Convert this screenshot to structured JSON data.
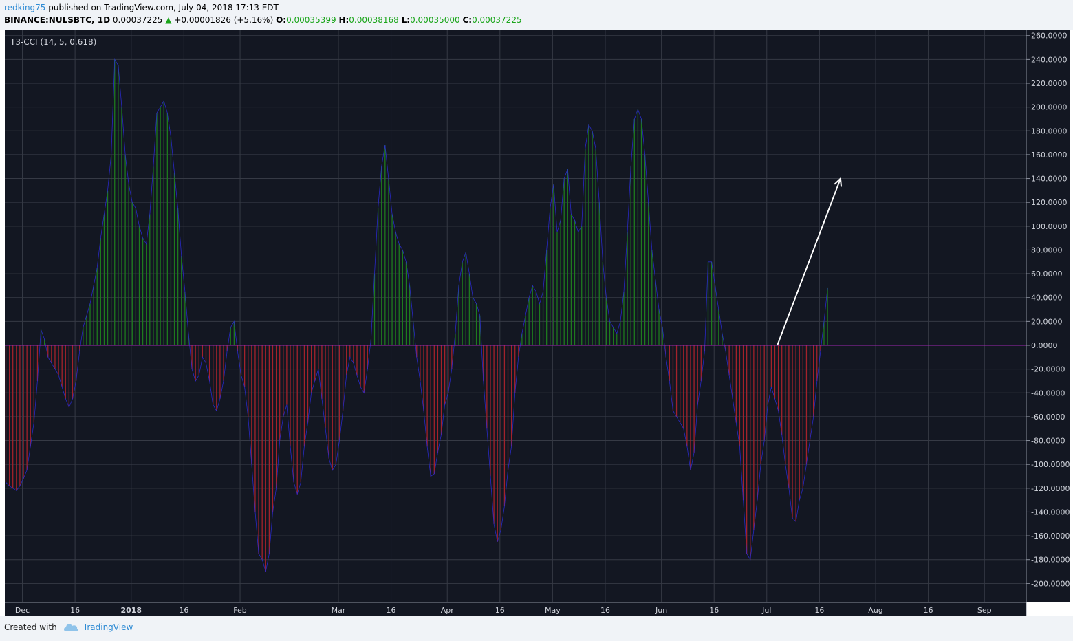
{
  "header": {
    "user": "redking75",
    "published": " published on TradingView.com, July 04, 2018 17:13 EDT",
    "symbol": "BINANCE:NULSBTC, 1D",
    "price": "0.00037225",
    "change": "+0.00001826 (+5.16%)",
    "o_label": "O:",
    "o_val": "0.00035399",
    "h_label": "H:",
    "h_val": "0.00038168",
    "l_label": "L:",
    "l_val": "0.00035000",
    "c_label": "C:",
    "c_val": "0.00037225"
  },
  "footer": {
    "created": "Created with",
    "brand": "TradingView"
  },
  "colors": {
    "background": "#131722",
    "grid": "#363a45",
    "positive": "#1e7a1e",
    "negative": "#a3222b",
    "outline": "#2b2bd6",
    "zero_line": "#9c27b0",
    "annotation": "#ffffff"
  },
  "chart_data": {
    "type": "bar",
    "indicator_label": "T3-CCI (14, 5, 0.618)",
    "ylim": [
      -200,
      260
    ],
    "y_ticks": [
      "260.0000",
      "240.0000",
      "220.0000",
      "200.0000",
      "180.0000",
      "160.0000",
      "140.0000",
      "120.0000",
      "100.0000",
      "80.0000",
      "60.0000",
      "40.0000",
      "20.0000",
      "0.0000",
      "-20.0000",
      "-40.0000",
      "-60.0000",
      "-80.0000",
      "-100.0000",
      "-120.0000",
      "-140.0000",
      "-160.0000",
      "-180.0000",
      "-200.0000"
    ],
    "x_ticks": [
      {
        "label": "Dec",
        "date": "2017-12-01"
      },
      {
        "label": "16",
        "date": "2017-12-16"
      },
      {
        "label": "2018",
        "date": "2018-01-01"
      },
      {
        "label": "16",
        "date": "2018-01-16"
      },
      {
        "label": "Feb",
        "date": "2018-02-01"
      },
      {
        "label": "Mar",
        "date": "2018-03-01"
      },
      {
        "label": "16",
        "date": "2018-03-16"
      },
      {
        "label": "Apr",
        "date": "2018-04-01"
      },
      {
        "label": "16",
        "date": "2018-04-16"
      },
      {
        "label": "May",
        "date": "2018-05-01"
      },
      {
        "label": "16",
        "date": "2018-05-16"
      },
      {
        "label": "Jun",
        "date": "2018-06-01"
      },
      {
        "label": "16",
        "date": "2018-06-16"
      },
      {
        "label": "Jul",
        "date": "2018-07-01"
      },
      {
        "label": "16",
        "date": "2018-07-16"
      },
      {
        "label": "Aug",
        "date": "2018-08-01"
      },
      {
        "label": "16",
        "date": "2018-08-16"
      },
      {
        "label": "Sep",
        "date": "2018-09-01"
      }
    ],
    "date_start": "2017-11-26",
    "date_end": "2018-09-13",
    "values": [
      -115,
      -118,
      -120,
      -122,
      -118,
      -112,
      -105,
      -85,
      -65,
      -30,
      13,
      5,
      -10,
      -15,
      -20,
      -25,
      -35,
      -45,
      -52,
      -45,
      -30,
      -5,
      15,
      25,
      35,
      50,
      65,
      90,
      110,
      130,
      160,
      240,
      235,
      200,
      160,
      135,
      120,
      115,
      100,
      90,
      85,
      110,
      150,
      195,
      200,
      205,
      195,
      175,
      145,
      115,
      75,
      45,
      10,
      -20,
      -30,
      -25,
      -10,
      -15,
      -30,
      -50,
      -55,
      -45,
      -30,
      -5,
      15,
      20,
      -5,
      -25,
      -35,
      -60,
      -100,
      -140,
      -175,
      -180,
      -190,
      -175,
      -140,
      -120,
      -80,
      -60,
      -50,
      -85,
      -115,
      -125,
      -115,
      -85,
      -65,
      -40,
      -30,
      -20,
      -45,
      -70,
      -95,
      -105,
      -100,
      -80,
      -55,
      -25,
      -10,
      -15,
      -25,
      -35,
      -40,
      -20,
      5,
      60,
      115,
      150,
      168,
      140,
      110,
      95,
      85,
      80,
      70,
      50,
      20,
      -10,
      -30,
      -55,
      -85,
      -110,
      -108,
      -90,
      -75,
      -50,
      -40,
      -20,
      10,
      50,
      70,
      78,
      60,
      40,
      35,
      25,
      -30,
      -70,
      -110,
      -150,
      -165,
      -155,
      -135,
      -105,
      -85,
      -40,
      -10,
      10,
      25,
      40,
      50,
      45,
      35,
      45,
      80,
      115,
      135,
      95,
      105,
      140,
      148,
      110,
      105,
      95,
      100,
      165,
      185,
      180,
      165,
      120,
      70,
      40,
      20,
      15,
      10,
      20,
      45,
      95,
      150,
      190,
      198,
      190,
      160,
      120,
      80,
      55,
      30,
      15,
      -10,
      -30,
      -55,
      -60,
      -65,
      -70,
      -85,
      -105,
      -90,
      -50,
      -30,
      -5,
      70,
      70,
      50,
      30,
      10,
      -5,
      -25,
      -45,
      -65,
      -85,
      -130,
      -175,
      -180,
      -155,
      -130,
      -100,
      -80,
      -50,
      -35,
      -45,
      -55,
      -75,
      -100,
      -120,
      -145,
      -148,
      -130,
      -120,
      -100,
      -80,
      -60,
      -30,
      -5,
      20,
      48
    ]
  },
  "annotation": {
    "type": "arrow",
    "from": {
      "date": "2018-07-04",
      "value": 0
    },
    "to": {
      "date": "2018-07-22",
      "value": 140
    }
  }
}
